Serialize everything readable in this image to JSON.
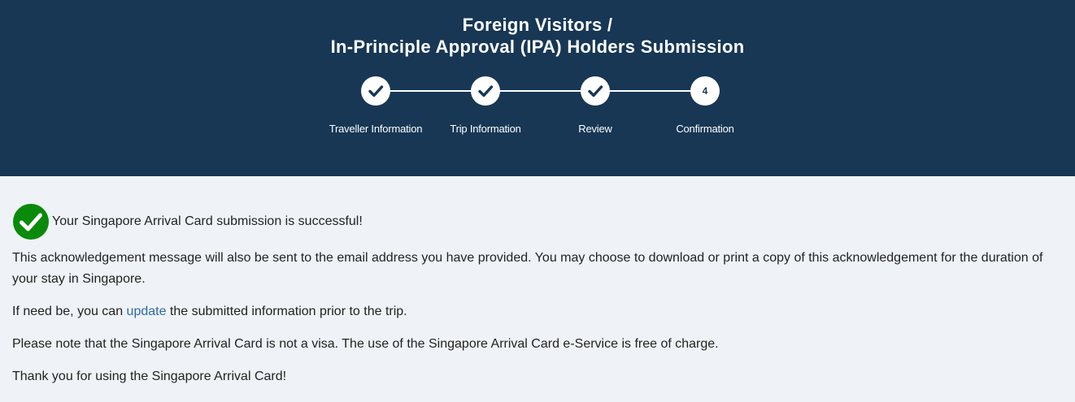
{
  "header": {
    "title_line1": "Foreign Visitors /",
    "title_line2": "In-Principle Approval (IPA) Holders Submission",
    "background": "#173755"
  },
  "stepper": {
    "steps": [
      {
        "label": "Traveller Information",
        "status": "complete",
        "icon": "check-icon"
      },
      {
        "label": "Trip Information",
        "status": "complete",
        "icon": "check-icon"
      },
      {
        "label": "Review",
        "status": "complete",
        "icon": "check-icon"
      },
      {
        "label": "Confirmation",
        "status": "current",
        "number": "4"
      }
    ]
  },
  "confirmation": {
    "success_icon": "check-circle-icon",
    "success_color": "#0a8a0a",
    "success_message": "Your Singapore Arrival Card submission is successful!",
    "ack_message": "This acknowledgement message will also be sent to the email address you have provided. You may choose to download or print a copy of this acknowledgement for the duration of your stay in Singapore.",
    "update_prefix": "If need be, you can ",
    "update_link": "update",
    "update_suffix": " the submitted information prior to the trip.",
    "visa_note": "Please note that the Singapore Arrival Card is not a visa. The use of the Singapore Arrival Card e-Service is free of charge.",
    "thanks": "Thank you for using the Singapore Arrival Card!",
    "link_color": "#2c6aa6"
  }
}
